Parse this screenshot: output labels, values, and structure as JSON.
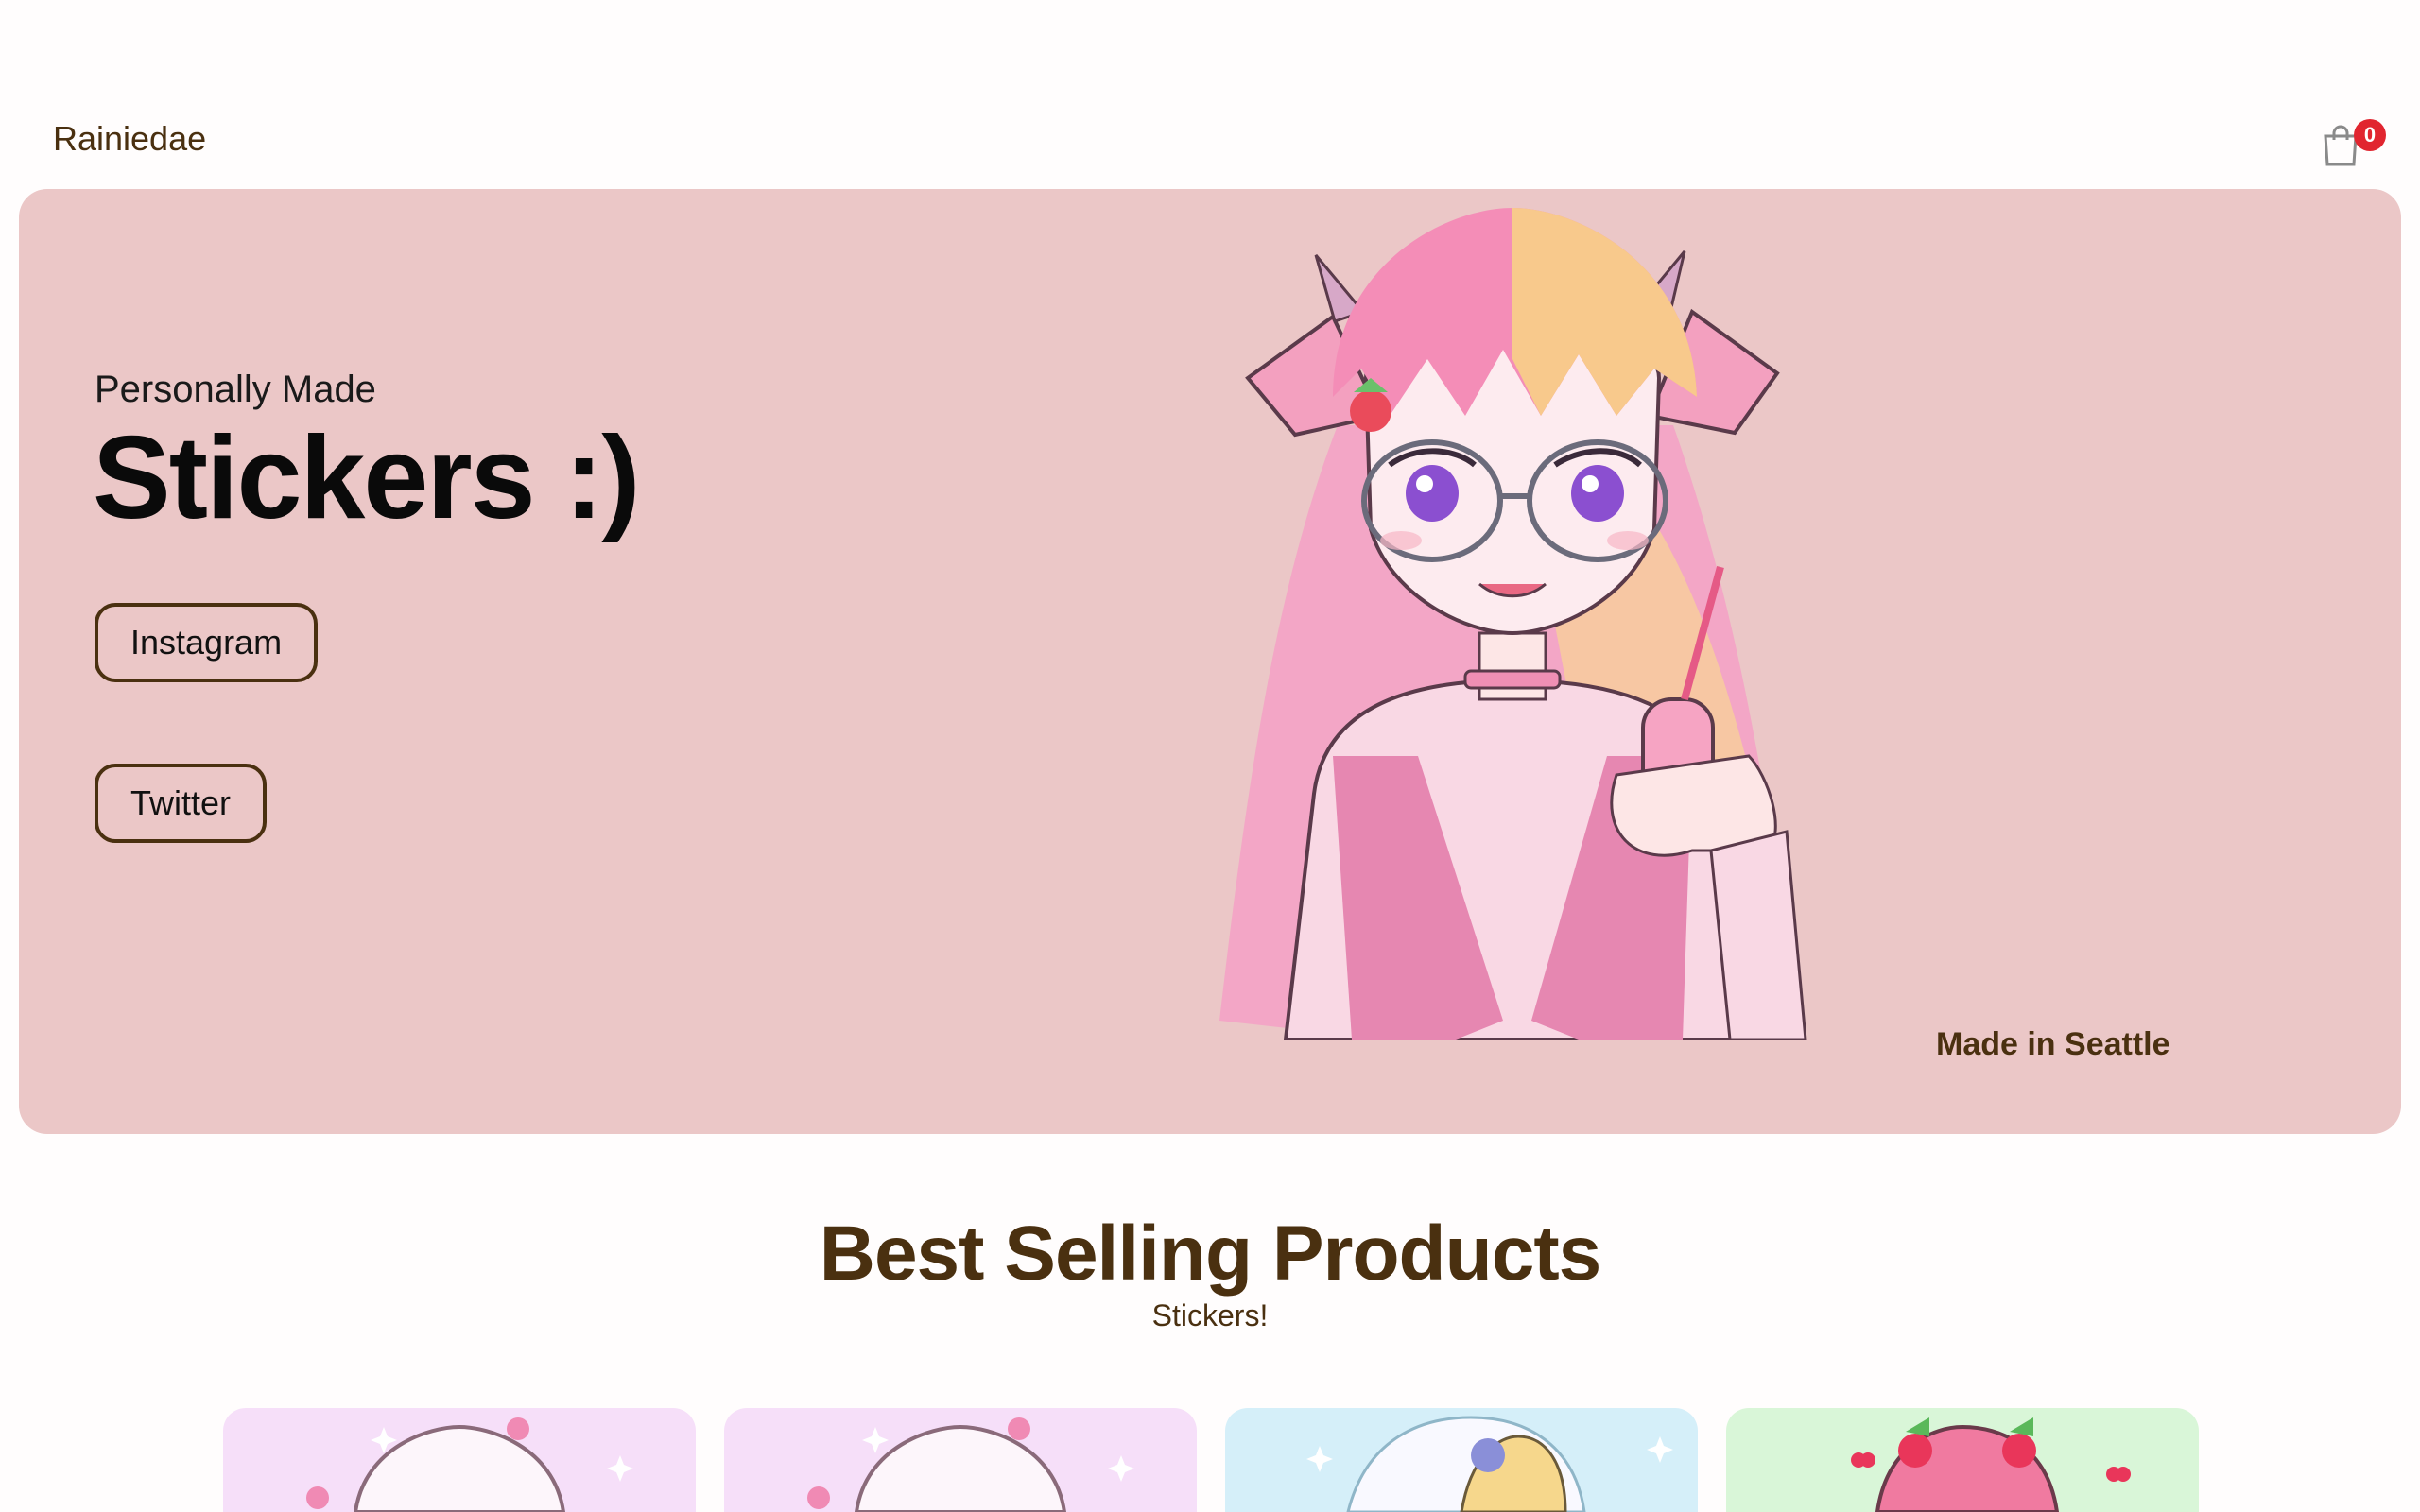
{
  "header": {
    "brand": "Rainiedae",
    "cart_count": "0",
    "cart_icon": "shopping-bag-icon"
  },
  "hero": {
    "kicker": "Personally Made",
    "title": "Stickers :)",
    "buttons": [
      {
        "label": "Instagram"
      },
      {
        "label": "Twitter"
      }
    ],
    "location": "Made in Seattle",
    "background_color": "#ebc7c7",
    "illustration": "anime-girl-sticker-illustration"
  },
  "products": {
    "title": "Best Selling Products",
    "subtitle": "Stickers!",
    "cards": [
      {
        "background_color": "#f6dff9"
      },
      {
        "background_color": "#f6dff9"
      },
      {
        "background_color": "#d5eff9"
      },
      {
        "background_color": "#d9f6d8"
      }
    ]
  },
  "colors": {
    "accent_brown": "#4a3010",
    "badge_red": "#e1252f"
  }
}
